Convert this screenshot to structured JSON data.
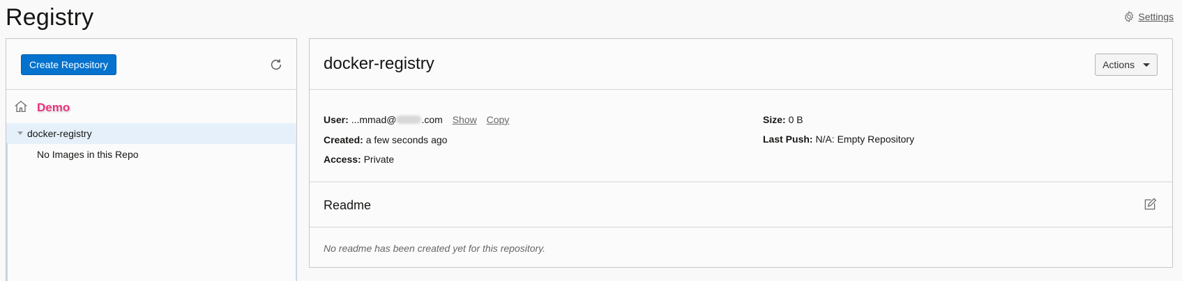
{
  "page": {
    "title": "Registry",
    "settings_label": "Settings"
  },
  "left_panel": {
    "create_button_label": "Create Repository",
    "refresh_icon": "refresh-icon",
    "compartment_icon": "home-icon",
    "compartment_name": "Demo",
    "tree": {
      "repo_name": "docker-registry",
      "empty_message": "No Images in this Repo"
    }
  },
  "repository": {
    "name": "docker-registry",
    "actions_label": "Actions",
    "details": {
      "user_label": "User:",
      "user_value_prefix": "...mmad@",
      "user_value_suffix": ".com",
      "show_label": "Show",
      "copy_label": "Copy",
      "created_label": "Created:",
      "created_value": "a few seconds ago",
      "access_label": "Access:",
      "access_value": "Private",
      "size_label": "Size:",
      "size_value": "0 B",
      "last_push_label": "Last Push:",
      "last_push_value": "N/A: Empty Repository"
    },
    "readme": {
      "title": "Readme",
      "edit_icon": "edit-icon",
      "empty_message": "No readme has been created yet for this repository."
    }
  },
  "colors": {
    "primary_button": "#0572ce",
    "selected_row": "#e6f0fa",
    "compartment_label": "#e8317a"
  }
}
